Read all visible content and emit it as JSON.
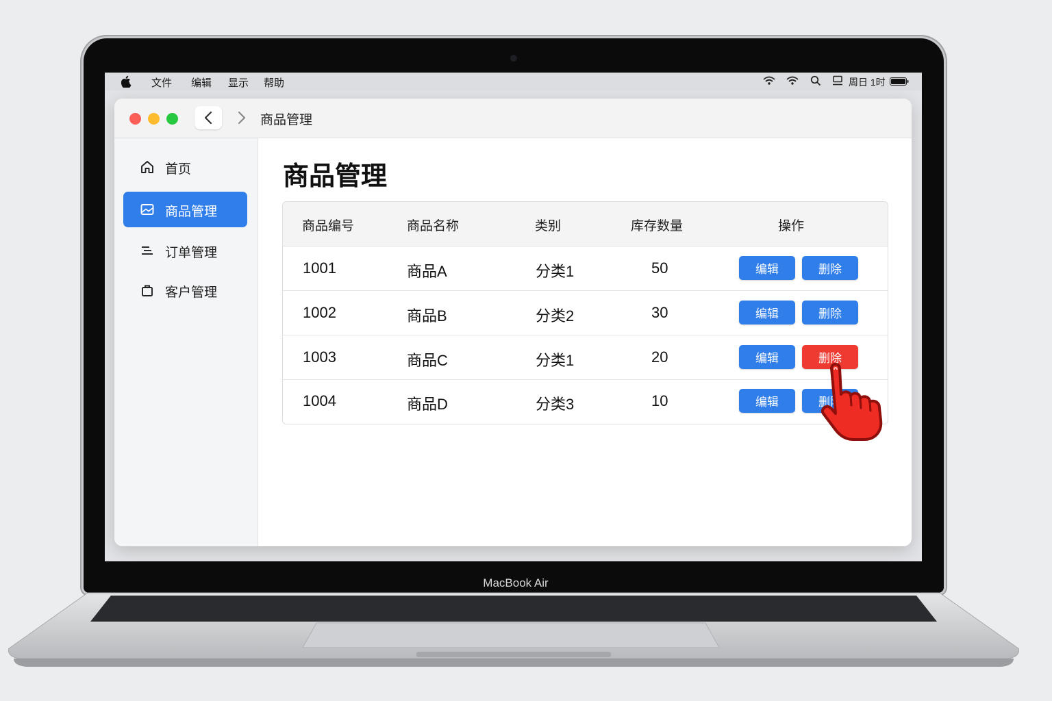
{
  "menubar": {
    "items": [
      "文件",
      "编辑",
      "显示",
      "帮助"
    ],
    "status_clock": "周日 1时"
  },
  "window": {
    "title": "商品管理"
  },
  "sidebar": {
    "items": [
      {
        "label": "首页",
        "icon": "home-icon",
        "active": false
      },
      {
        "label": "商品管理",
        "icon": "image-icon",
        "active": true
      },
      {
        "label": "订单管理",
        "icon": "list-icon",
        "active": false
      },
      {
        "label": "客户管理",
        "icon": "bag-icon",
        "active": false
      }
    ]
  },
  "main": {
    "page_title": "商品管理",
    "table": {
      "columns": [
        "商品编号",
        "商品名称",
        "类别",
        "库存数量",
        "操作"
      ],
      "rows": [
        {
          "id": "1001",
          "name": "商品A",
          "category": "分类1",
          "stock": "50"
        },
        {
          "id": "1002",
          "name": "商品B",
          "category": "分类2",
          "stock": "30"
        },
        {
          "id": "1003",
          "name": "商品C",
          "category": "分类1",
          "stock": "20"
        },
        {
          "id": "1004",
          "name": "商品D",
          "category": "分类3",
          "stock": "10"
        }
      ],
      "edit_label": "编辑",
      "delete_label": "删除"
    }
  },
  "device": {
    "brand": "MacBook Air"
  },
  "colors": {
    "accent": "#2f7ee9",
    "danger": "#ef3a32"
  }
}
